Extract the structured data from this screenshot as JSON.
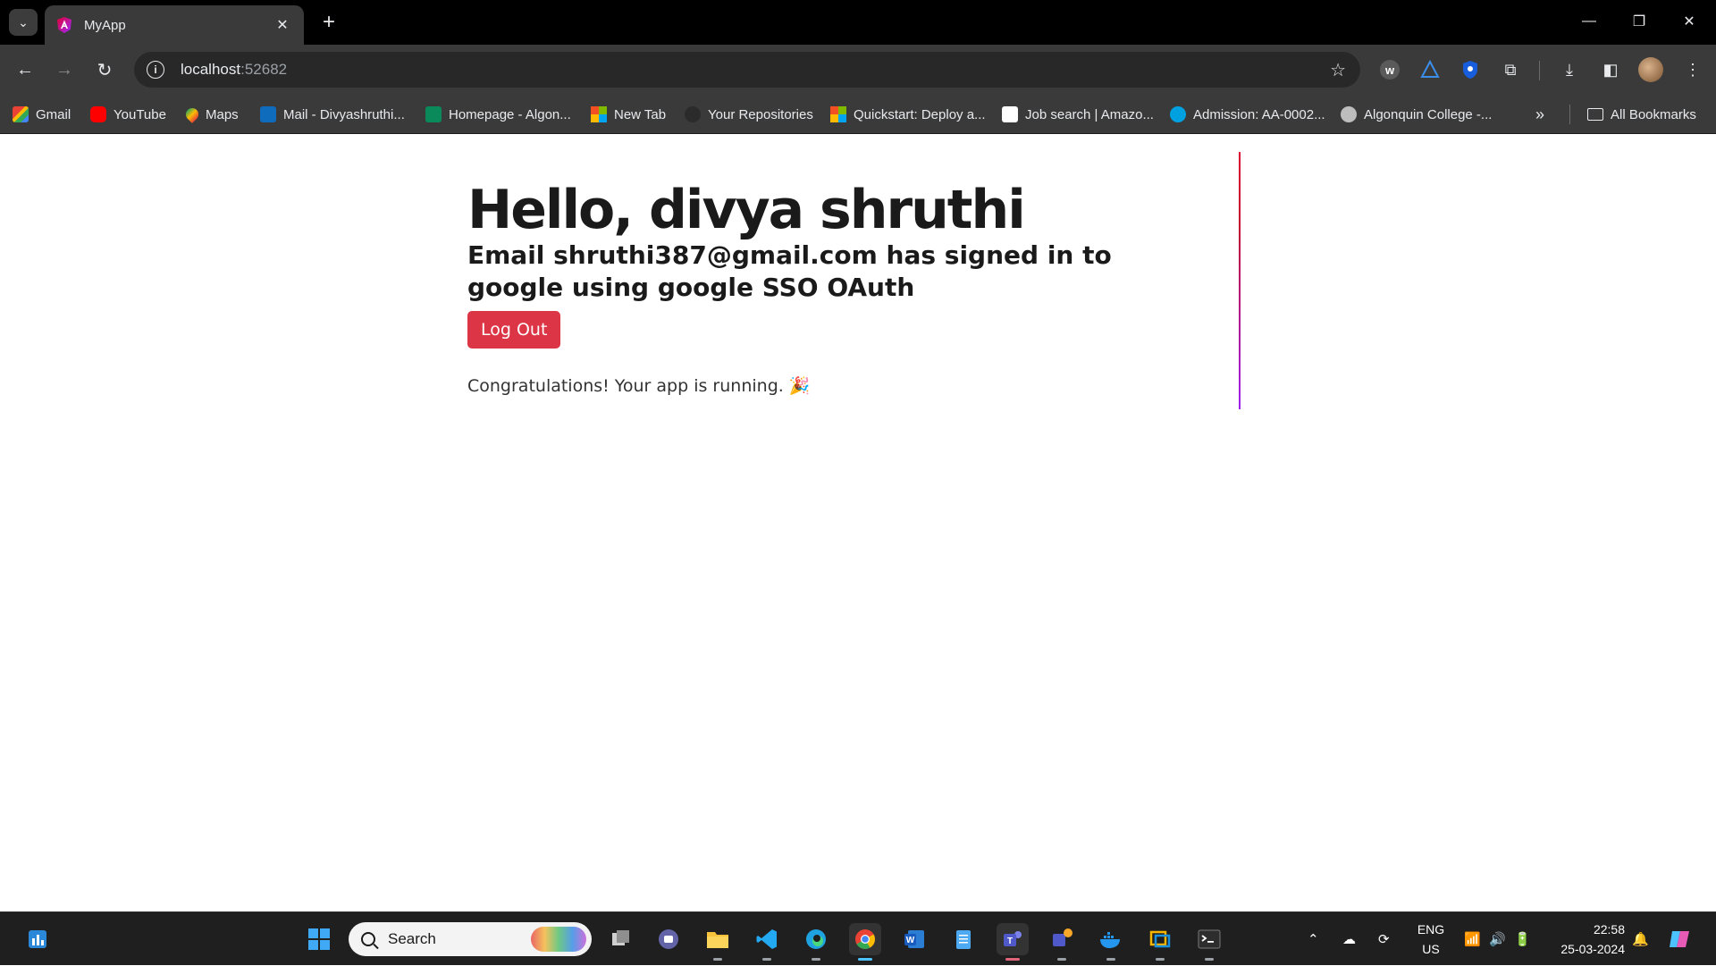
{
  "browser": {
    "tab": {
      "title": "MyApp"
    },
    "url": {
      "host": "localhost",
      "port": ":52682"
    },
    "bookmarks": [
      {
        "label": "Gmail",
        "icon": "gmail-icon"
      },
      {
        "label": "YouTube",
        "icon": "youtube-icon"
      },
      {
        "label": "Maps",
        "icon": "maps-icon"
      },
      {
        "label": "Mail - Divyashruthi...",
        "icon": "outlook-icon"
      },
      {
        "label": "Homepage - Algon...",
        "icon": "algonquin-icon"
      },
      {
        "label": "New Tab",
        "icon": "microsoft-icon"
      },
      {
        "label": "Your Repositories",
        "icon": "github-icon"
      },
      {
        "label": "Quickstart: Deploy a...",
        "icon": "microsoft-icon"
      },
      {
        "label": "Job search | Amazo...",
        "icon": "amazon-icon"
      },
      {
        "label": "Admission: AA-0002...",
        "icon": "salesforce-icon"
      },
      {
        "label": "Algonquin College -...",
        "icon": "globe-icon"
      }
    ],
    "all_bookmarks": "All Bookmarks"
  },
  "page": {
    "greeting": "Hello, divya shruthi",
    "email_message": "Email shruthi387@gmail.com has signed in to google using google SSO OAuth",
    "logout_label": "Log Out",
    "congrats": "Congratulations! Your app is running. 🎉"
  },
  "taskbar": {
    "search_placeholder": "Search",
    "language": "ENG",
    "region": "US",
    "time": "22:58",
    "date": "25-03-2024"
  },
  "colors": {
    "logout_button": "#dc3545",
    "chrome_dark": "#3a3a3a",
    "divider_top": "#dd0031",
    "divider_bottom": "#a020f0"
  }
}
